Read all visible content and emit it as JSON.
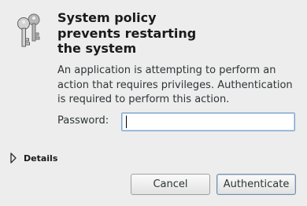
{
  "dialog": {
    "title": "System policy\nprevents restarting\nthe system",
    "message": "An application is attempting to perform an action that requires privileges. Authentication is required to perform this action.",
    "icon": "keys-icon"
  },
  "password": {
    "label": "Password:",
    "value": ""
  },
  "details": {
    "label": "Details",
    "expanded": false,
    "icon": "expander-arrow-icon"
  },
  "buttons": {
    "cancel_label": "Cancel",
    "authenticate_label": "Authenticate"
  },
  "colors": {
    "background": "#ededed",
    "focus_border": "#7ea6cf"
  }
}
